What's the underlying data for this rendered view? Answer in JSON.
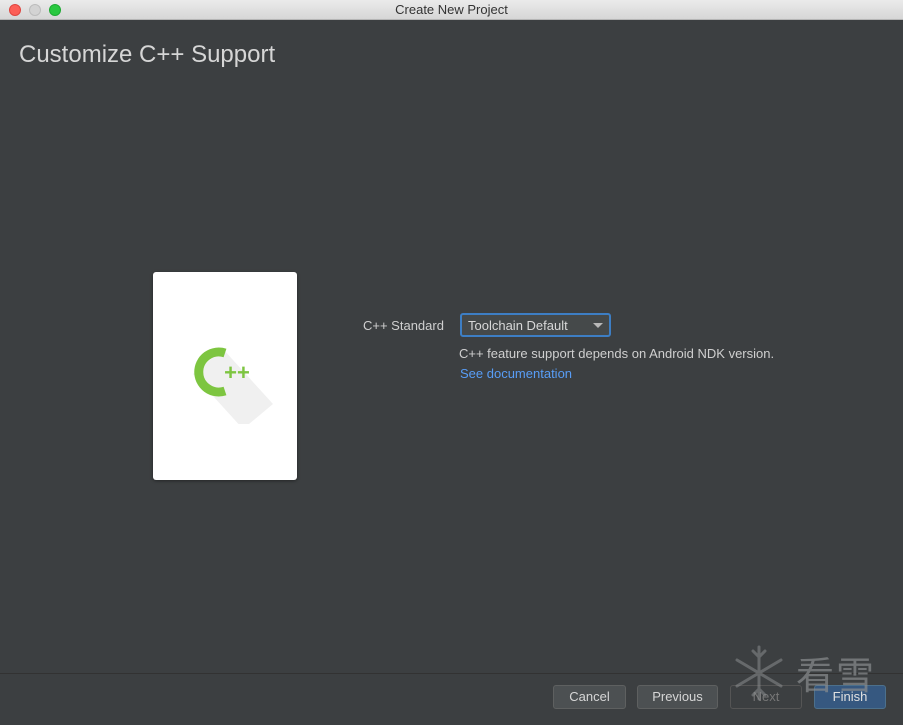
{
  "window": {
    "title": "Create New Project"
  },
  "header": {
    "title": "Customize C++ Support"
  },
  "illustration": {
    "icon": "cpp-logo-icon",
    "logo_text": "++",
    "accent_color": "#7dc540"
  },
  "form": {
    "cpp_standard_label": "C++ Standard",
    "cpp_standard_value": "Toolchain Default",
    "hint": "C++ feature support depends on Android NDK version.",
    "doc_link": "See documentation"
  },
  "footer": {
    "cancel_label": "Cancel",
    "previous_label": "Previous",
    "next_label": "Next",
    "finish_label": "Finish"
  },
  "watermark": {
    "text": "看雪",
    "icon": "snowflake-icon"
  },
  "colors": {
    "background": "#3c3f41",
    "link": "#589df6",
    "focus_border": "#3d7ec4",
    "primary_button": "#365880"
  }
}
